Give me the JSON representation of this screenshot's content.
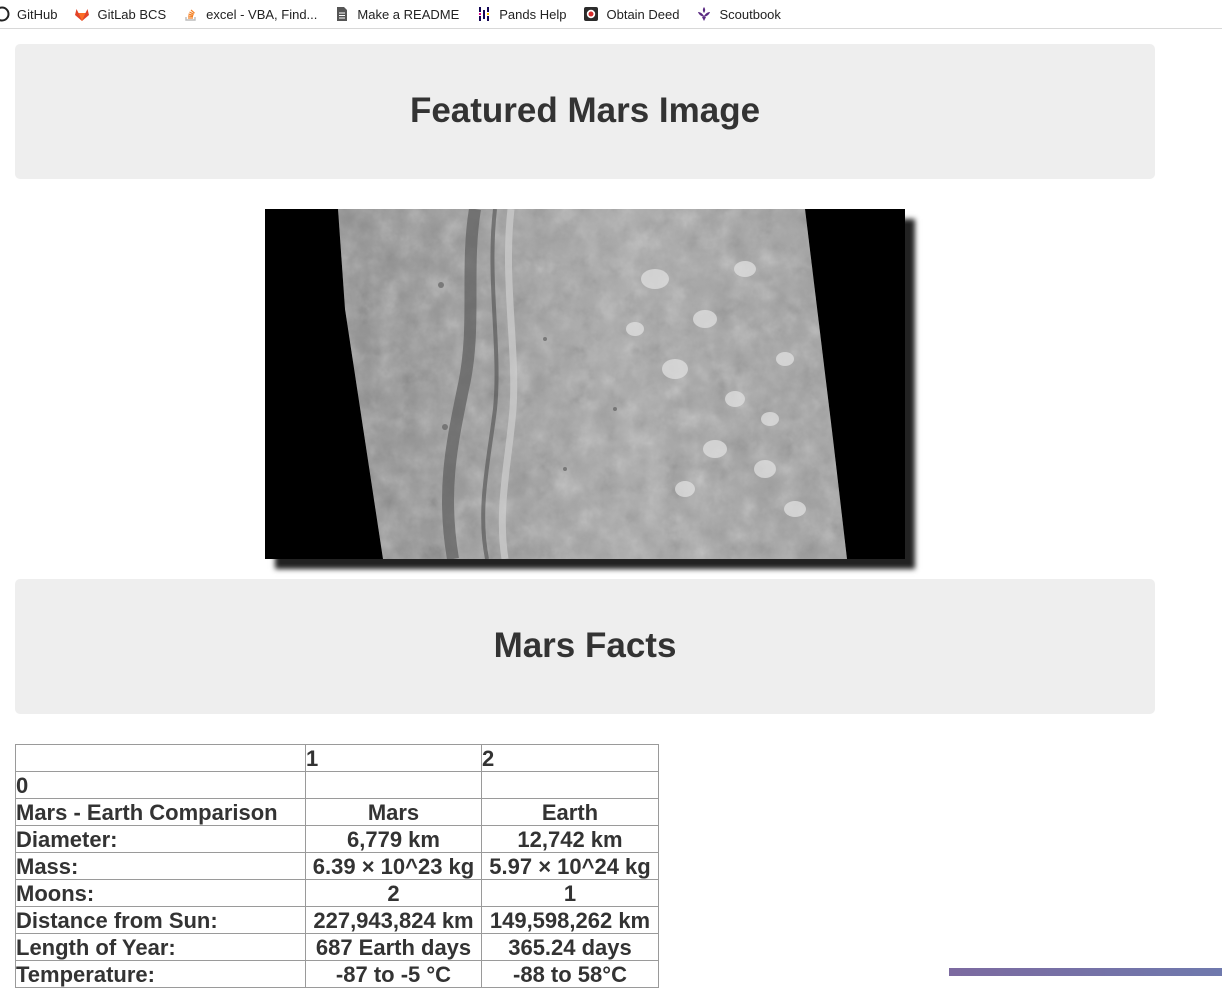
{
  "bookmarks": [
    {
      "label": "GitHub",
      "icon": "github-icon"
    },
    {
      "label": "GitLab BCS",
      "icon": "gitlab-icon"
    },
    {
      "label": "excel - VBA, Find...",
      "icon": "stackoverflow-icon"
    },
    {
      "label": "Make a README",
      "icon": "document-icon"
    },
    {
      "label": "Pands Help",
      "icon": "pandas-icon"
    },
    {
      "label": "Obtain Deed",
      "icon": "deed-icon"
    },
    {
      "label": "Scoutbook",
      "icon": "scout-icon"
    }
  ],
  "featured": {
    "title": "Featured Mars Image"
  },
  "facts": {
    "title": "Mars Facts",
    "table": {
      "header": [
        "",
        "1",
        "2"
      ],
      "index_name": "0",
      "rows": [
        [
          "Mars - Earth Comparison",
          "Mars",
          "Earth"
        ],
        [
          "Diameter:",
          "6,779 km",
          "12,742 km"
        ],
        [
          "Mass:",
          "6.39 × 10^23 kg",
          "5.97 × 10^24 kg"
        ],
        [
          "Moons:",
          "2",
          "1"
        ],
        [
          "Distance from Sun:",
          "227,943,824 km",
          "149,598,262 km"
        ],
        [
          "Length of Year:",
          "687 Earth days",
          "365.24 days"
        ],
        [
          "Temperature:",
          "-87 to -5 °C",
          "-88 to 58°C"
        ]
      ]
    }
  },
  "colors": {
    "jumbotron_bg": "#eeeeee",
    "heading_text": "#333333"
  }
}
